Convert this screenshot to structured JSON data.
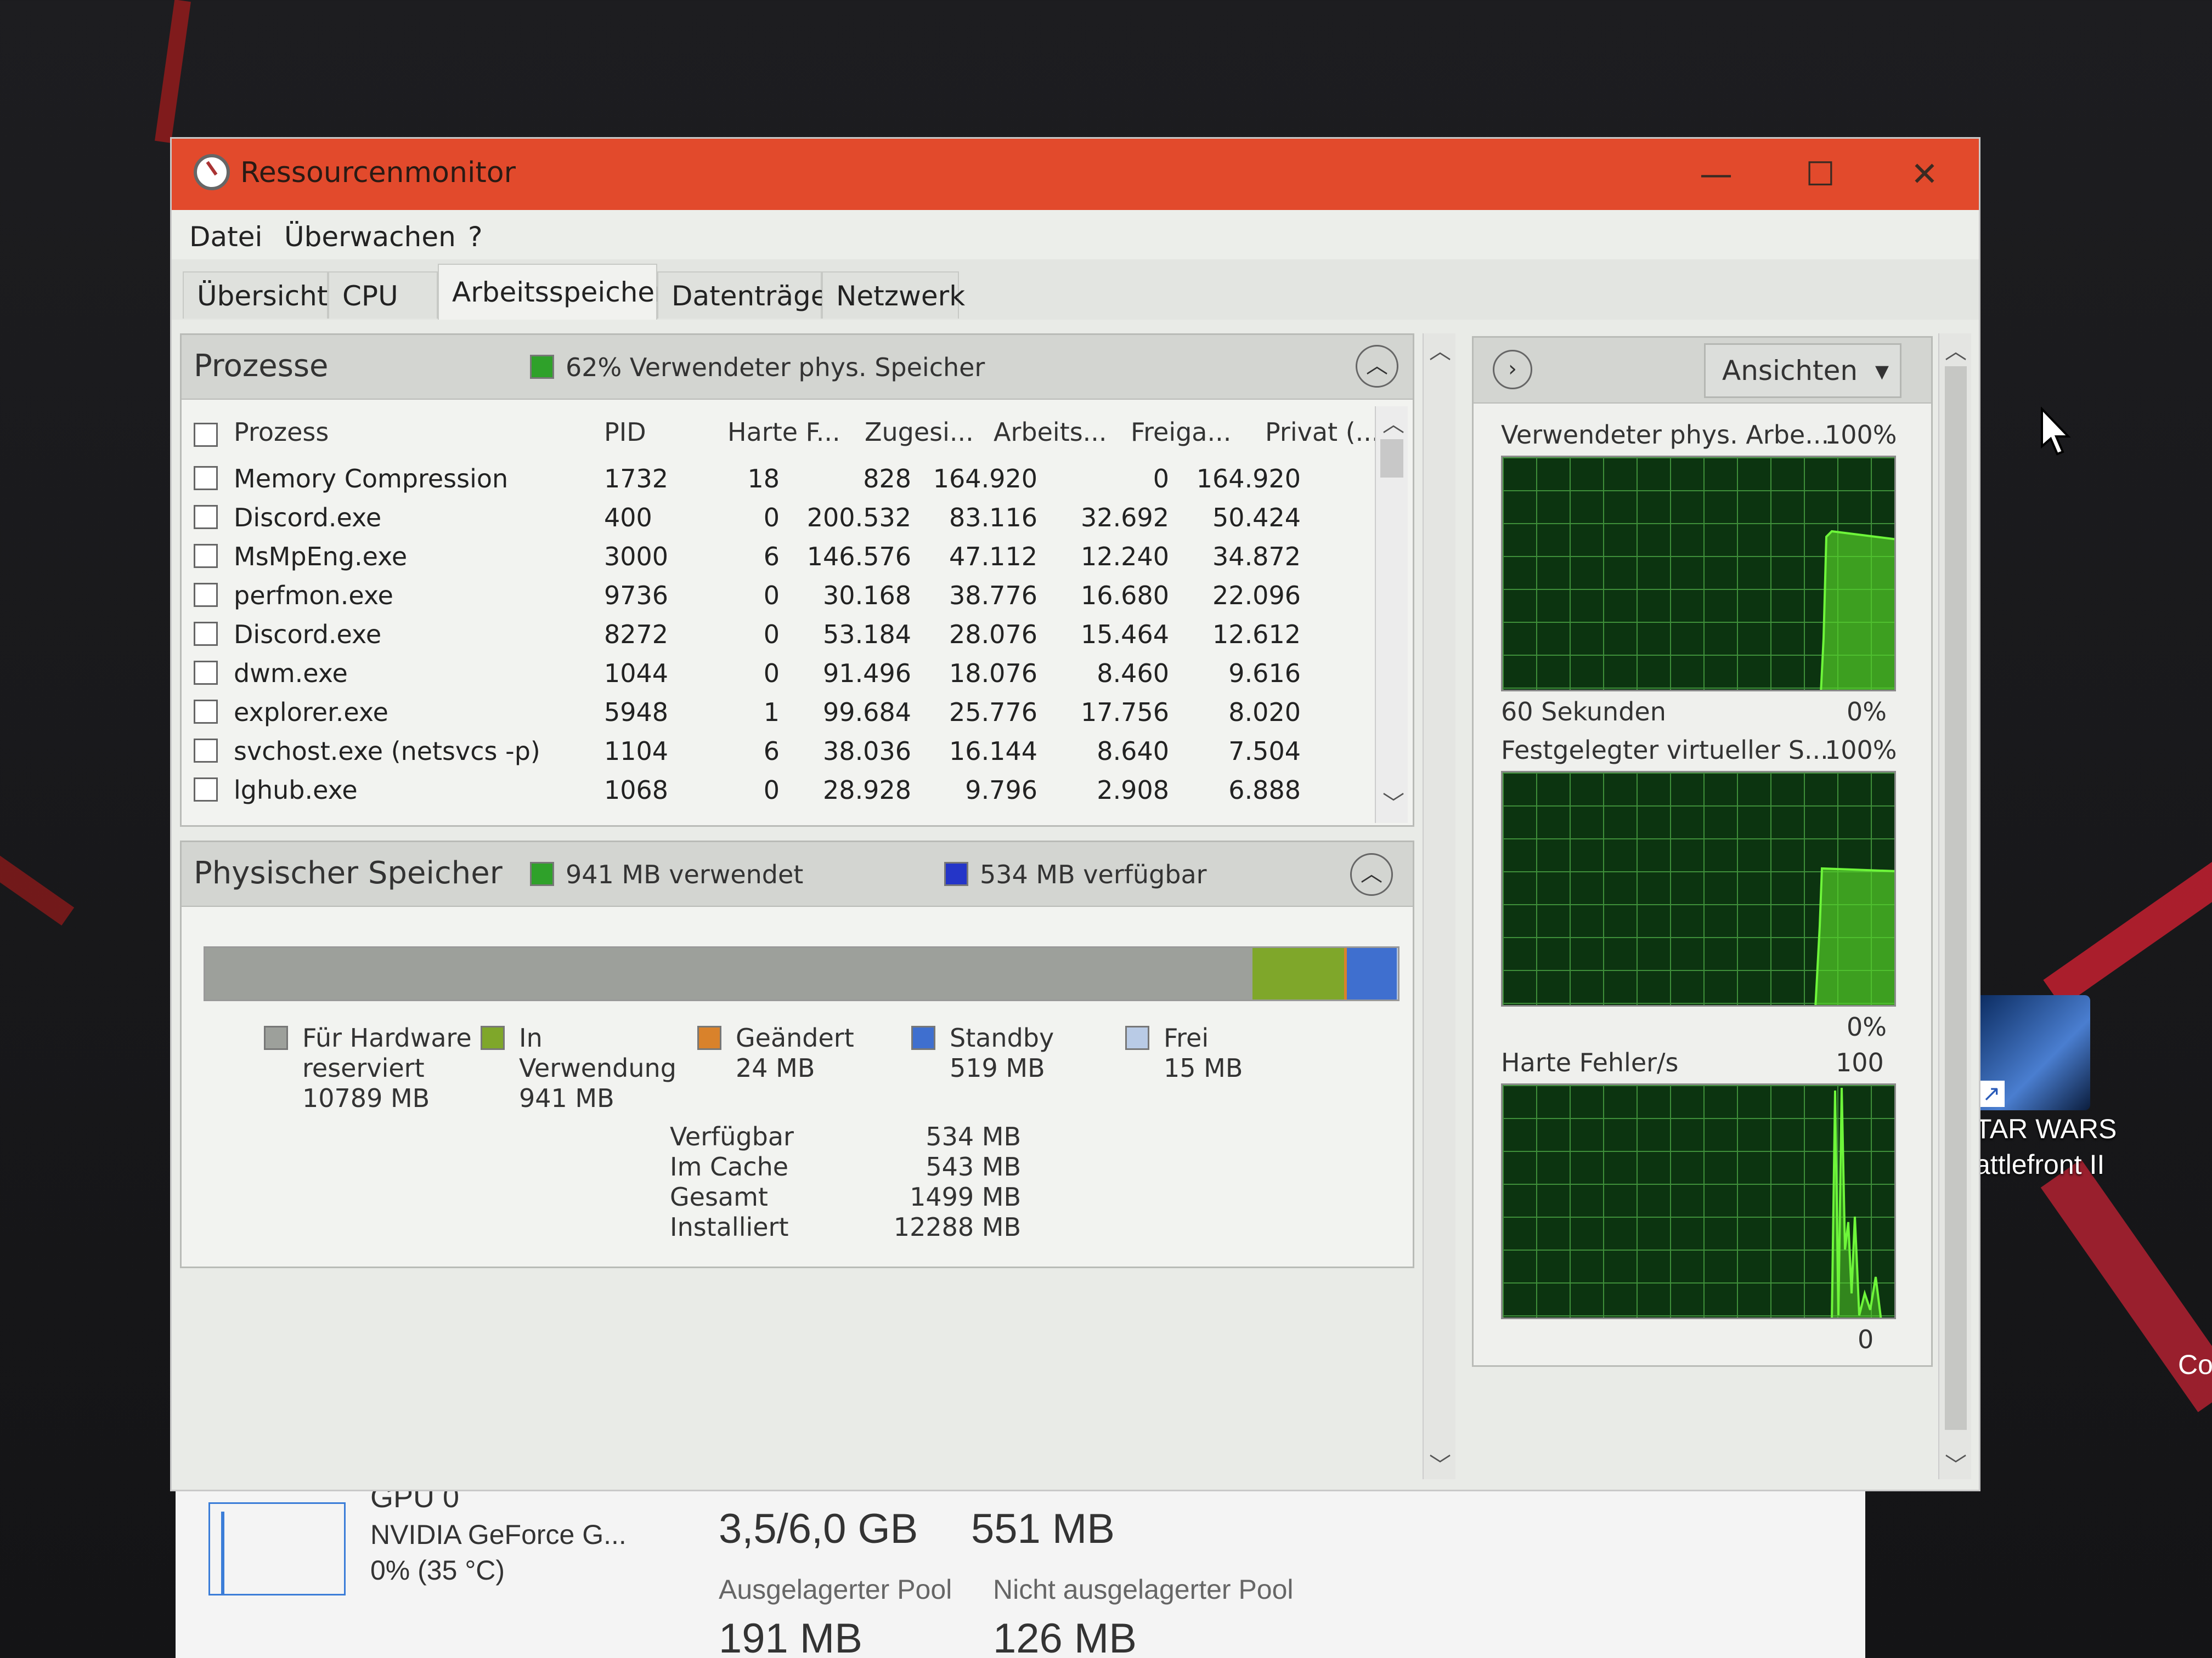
{
  "window": {
    "title": "Ressourcenmonitor",
    "controls": {
      "minimize": "—",
      "maximize": "☐",
      "close": "✕"
    }
  },
  "menu": [
    "Datei",
    "Überwachen",
    "?"
  ],
  "tabs": [
    {
      "label": "Übersicht",
      "active": false
    },
    {
      "label": "CPU",
      "active": false
    },
    {
      "label": "Arbeitsspeicher",
      "active": true
    },
    {
      "label": "Datenträger",
      "active": false
    },
    {
      "label": "Netzwerk",
      "active": false
    }
  ],
  "processes": {
    "title": "Prozesse",
    "summary": "62% Verwendeter phys. Speicher",
    "summary_color": "#2fa12a",
    "columns": [
      "Prozess",
      "PID",
      "Harte F...",
      "Zugesi...",
      "Arbeits...",
      "Freiga...",
      "Privat (..."
    ],
    "rows": [
      [
        "Memory Compression",
        "1732",
        "18",
        "828",
        "164.920",
        "0",
        "164.920"
      ],
      [
        "Discord.exe",
        "400",
        "0",
        "200.532",
        "83.116",
        "32.692",
        "50.424"
      ],
      [
        "MsMpEng.exe",
        "3000",
        "6",
        "146.576",
        "47.112",
        "12.240",
        "34.872"
      ],
      [
        "perfmon.exe",
        "9736",
        "0",
        "30.168",
        "38.776",
        "16.680",
        "22.096"
      ],
      [
        "Discord.exe",
        "8272",
        "0",
        "53.184",
        "28.076",
        "15.464",
        "12.612"
      ],
      [
        "dwm.exe",
        "1044",
        "0",
        "91.496",
        "18.076",
        "8.460",
        "9.616"
      ],
      [
        "explorer.exe",
        "5948",
        "1",
        "99.684",
        "25.776",
        "17.756",
        "8.020"
      ],
      [
        "svchost.exe (netsvcs -p)",
        "1104",
        "6",
        "38.036",
        "16.144",
        "8.640",
        "7.504"
      ],
      [
        "lghub.exe",
        "1068",
        "0",
        "28.928",
        "9.796",
        "2.908",
        "6.888"
      ]
    ]
  },
  "physical": {
    "title": "Physischer Speicher",
    "used_legend": "941 MB verwendet",
    "avail_legend": "534 MB verfügbar",
    "colors": {
      "hardware": "#9da09b",
      "in_use": "#7fa72a",
      "modified": "#d9822b",
      "standby": "#3f6fcf",
      "free": "#b9cbe6"
    },
    "legend": [
      {
        "name": "Für Hardware reserviert",
        "line1": "Für Hardware",
        "line2": "reserviert",
        "value": "10789 MB"
      },
      {
        "name": "In Verwendung",
        "line1": "In",
        "line2": "Verwendung",
        "value": "941 MB"
      },
      {
        "name": "Geändert",
        "line1": "Geändert",
        "line2": "",
        "value": "24 MB"
      },
      {
        "name": "Standby",
        "line1": "Standby",
        "line2": "",
        "value": "519 MB"
      },
      {
        "name": "Frei",
        "line1": "Frei",
        "line2": "",
        "value": "15 MB"
      }
    ],
    "stats": [
      {
        "label": "Verfügbar",
        "value": "534 MB"
      },
      {
        "label": "Im Cache",
        "value": "543 MB"
      },
      {
        "label": "Gesamt",
        "value": "1499 MB"
      },
      {
        "label": "Installiert",
        "value": "12288 MB"
      }
    ],
    "bar_fractions": {
      "hardware": 0.878,
      "in_use": 0.077,
      "modified": 0.002,
      "standby": 0.042,
      "free": 0.001
    }
  },
  "graphs": {
    "views_button": "Ansichten",
    "items": [
      {
        "title": "Verwendeter phys. Arbe...",
        "max": "100%",
        "footer_left": "60 Sekunden",
        "footer_right": "0%"
      },
      {
        "title": "Festgelegter virtueller S...",
        "max": "100%",
        "footer_left": "",
        "footer_right": "0%"
      },
      {
        "title": "Harte Fehler/s",
        "max": "100",
        "footer_left": "",
        "footer_right": "0"
      }
    ]
  },
  "taskmanager": {
    "gpu_name": "GPU 0",
    "gpu_model": "NVIDIA GeForce G...",
    "gpu_usage": "0% (35 °C)",
    "dedicated": "3,5/6,0 GB",
    "shared": "551 MB",
    "paged_label": "Ausgelagerter Pool",
    "paged_value": "191 MB",
    "nonpaged_label": "Nicht ausgelagerter Pool",
    "nonpaged_value": "126 MB"
  },
  "desktop": {
    "icon_label_line1": "TAR WARS",
    "icon_label_line2": "attlefront II",
    "edge_text": "Co"
  }
}
